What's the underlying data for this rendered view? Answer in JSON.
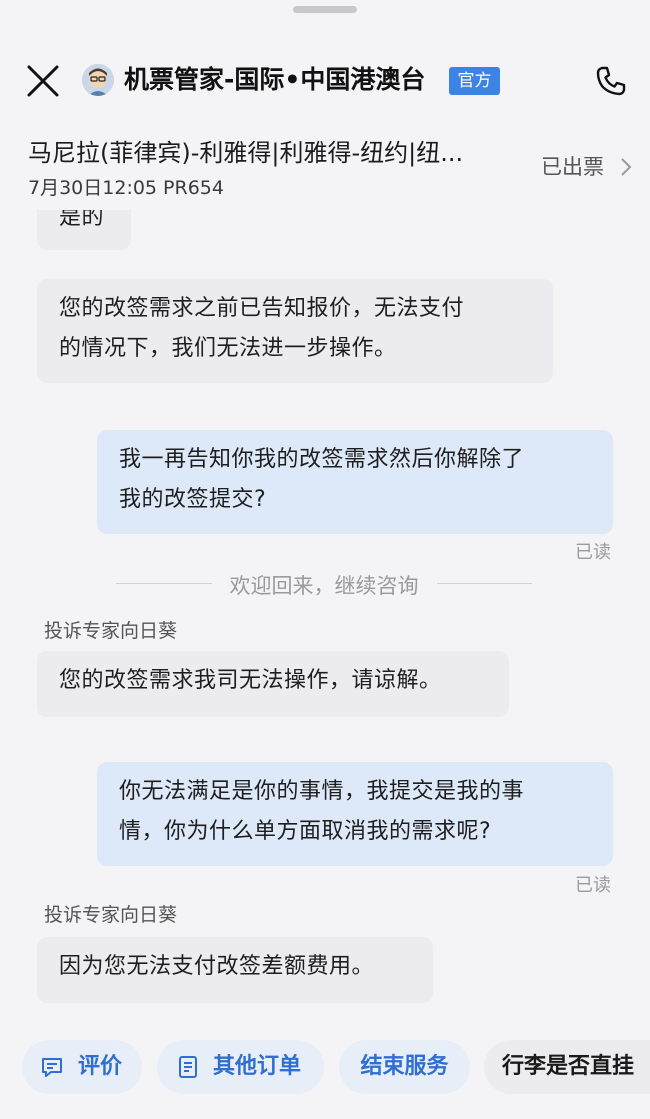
{
  "header": {
    "title": "机票管家-国际•中国港澳台",
    "badge": "官方"
  },
  "trip": {
    "route": "马尼拉(菲律宾)-利雅得|利雅得-纽约|纽...",
    "meta": "7月30日12:05 PR654",
    "status": "已出票"
  },
  "messages": {
    "partial": "是的",
    "m1_line1": "您的改签需求之前已告知报价，无法支付",
    "m1_line2": "的情况下，我们无法进一步操作。",
    "m2_line1": "我一再告知你我的改签需求然后你解除了",
    "m2_line2": "我的改签提交?",
    "m2_read": "已读",
    "divider": "欢迎回来，继续咨询",
    "sender1": "投诉专家向日葵",
    "m3": "您的改签需求我司无法操作，请谅解。",
    "m4_line1": "你无法满足是你的事情，我提交是我的事",
    "m4_line2": "情，你为什么单方面取消我的需求呢?",
    "m4_read": "已读",
    "sender2": "投诉专家向日葵",
    "m5": "因为您无法支付改签差额费用。"
  },
  "quick_actions": {
    "rate": "评价",
    "other_orders": "其他订单",
    "end_service": "结束服务",
    "luggage": "行李是否直挂"
  },
  "colors": {
    "accent": "#3b84e6",
    "chip_text": "#2f6fd1",
    "incoming_bubble": "#ececf0",
    "outgoing_bubble": "#dde9f9"
  }
}
